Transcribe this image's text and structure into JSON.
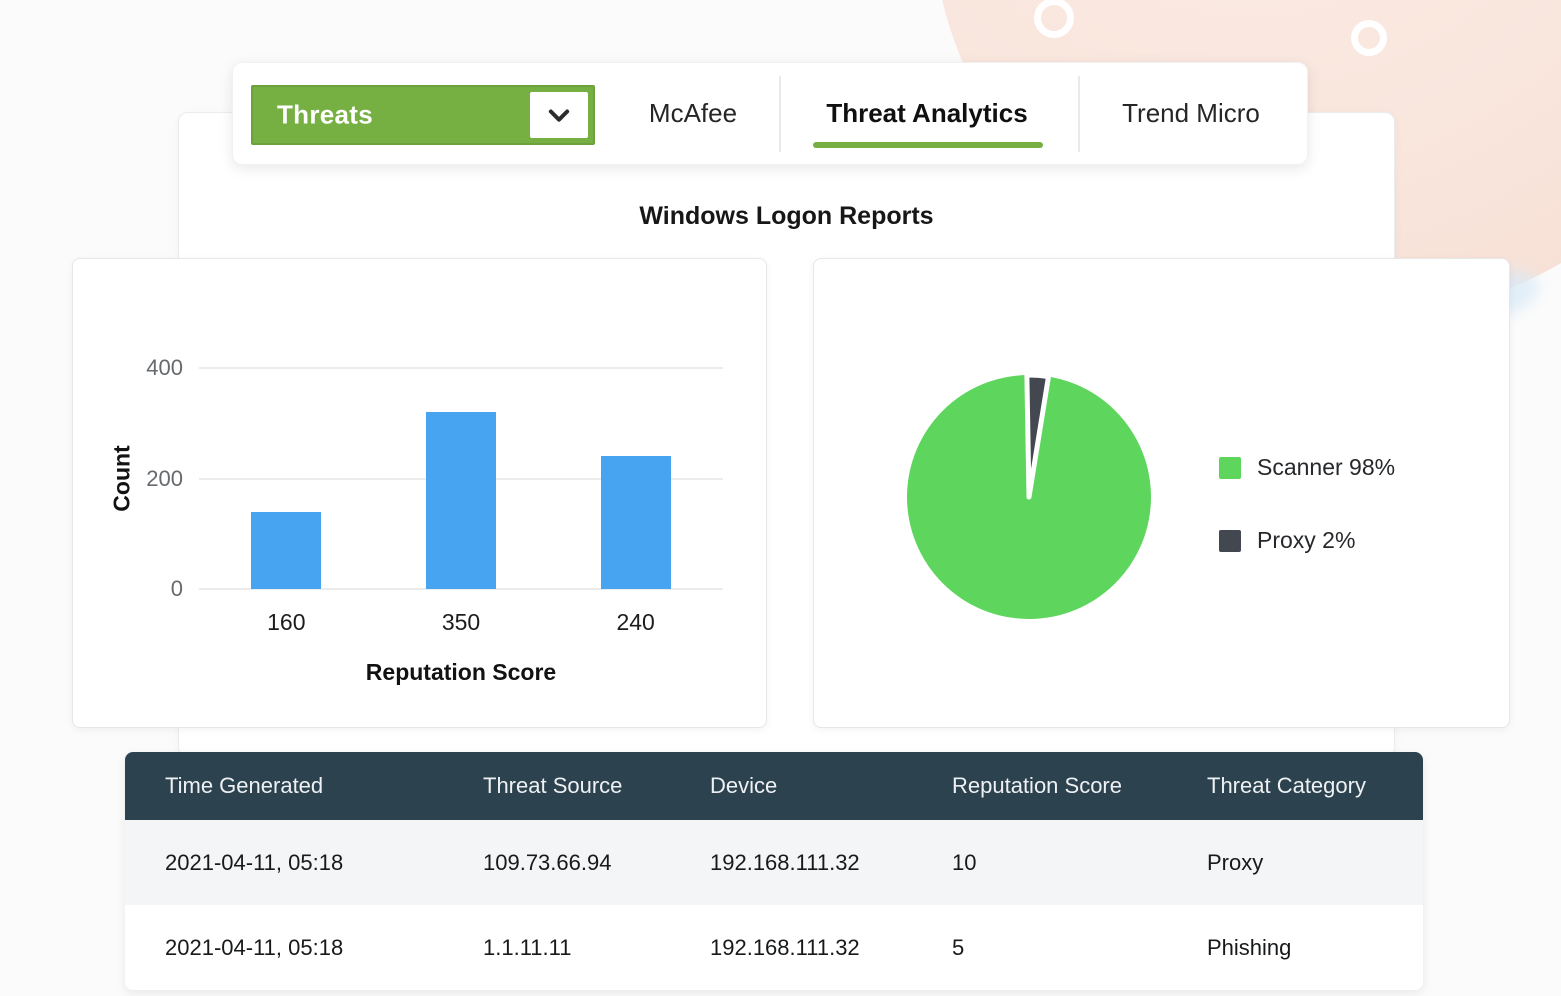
{
  "page": {
    "title": "Windows Logon Reports"
  },
  "tabs": {
    "dropdown": {
      "label": "Threats",
      "icon": "chevron-down-icon"
    },
    "items": [
      {
        "label": "McAfee",
        "active": false
      },
      {
        "label": "Threat Analytics",
        "active": true
      },
      {
        "label": "Trend Micro",
        "active": false
      }
    ]
  },
  "colors": {
    "accent_green": "#76b043",
    "pie_green": "#5ed65e",
    "pie_dark": "#424750",
    "bar_blue": "#47a4f0",
    "table_header_bg": "#2d424f",
    "blob_peach": "#f6ddd2"
  },
  "chart_data": [
    {
      "type": "bar",
      "title": "",
      "categories": [
        "160",
        "350",
        "240"
      ],
      "values": [
        140,
        320,
        240
      ],
      "xlabel": "Reputation Score",
      "ylabel": "Count",
      "ylim": [
        0,
        400
      ],
      "yticks": [
        0,
        200,
        400
      ],
      "grid": true,
      "bar_color": "#47a4f0",
      "legend_position": "none"
    },
    {
      "type": "pie",
      "title": "",
      "slices": [
        {
          "label": "Scanner",
          "pct": 98,
          "color": "#5ed65e"
        },
        {
          "label": "Proxy",
          "pct": 2,
          "color": "#424750"
        }
      ],
      "start_angle_deg": -1,
      "legend_position": "right"
    }
  ],
  "table": {
    "headers": [
      "Time Generated",
      "Threat Source",
      "Device",
      "Reputation Score",
      "Threat Category"
    ],
    "rows": [
      [
        "2021-04-11, 05:18",
        "109.73.66.94",
        "192.168.111.32",
        "10",
        "Proxy"
      ],
      [
        "2021-04-11, 05:18",
        "1.1.11.11",
        "192.168.111.32",
        "5",
        "Phishing"
      ]
    ]
  }
}
